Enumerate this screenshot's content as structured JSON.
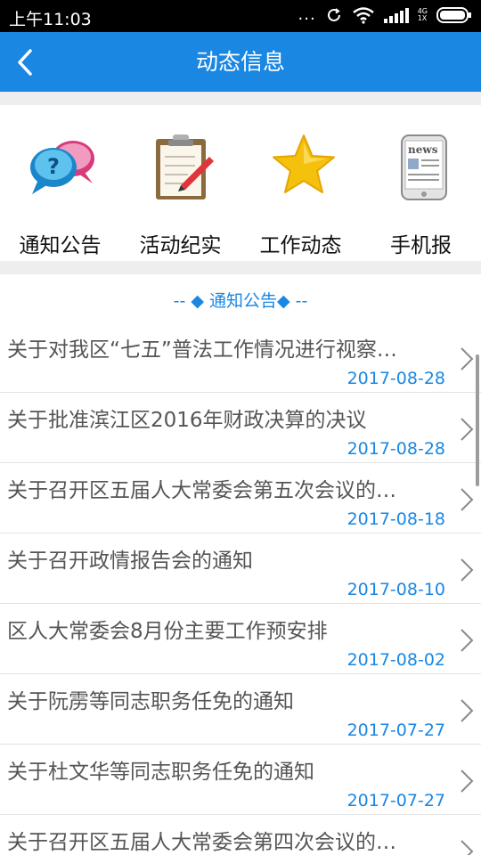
{
  "status_bar": {
    "time": "上午11:03",
    "dots": "...",
    "network": "4G",
    "network_sub": "1X"
  },
  "header": {
    "title": "动态信息",
    "back_icon": "chevron-left-icon"
  },
  "quick_menu": [
    {
      "label": "通知公告",
      "icon": "speech-bubbles-question-icon"
    },
    {
      "label": "活动纪实",
      "icon": "clipboard-pen-icon"
    },
    {
      "label": "工作动态",
      "icon": "star-icon"
    },
    {
      "label": "手机报",
      "icon": "news-phone-icon"
    }
  ],
  "section": {
    "title": "-- ◆ 通知公告◆ --"
  },
  "news": [
    {
      "title": "关于对我区“七五”普法工作情况进行视察…",
      "date": "2017-08-28"
    },
    {
      "title": "关于批准滨江区2016年财政决算的决议",
      "date": "2017-08-28"
    },
    {
      "title": "关于召开区五届人大常委会第五次会议的…",
      "date": "2017-08-18"
    },
    {
      "title": "关于召开政情报告会的通知",
      "date": "2017-08-10"
    },
    {
      "title": "区人大常委会8月份主要工作预安排",
      "date": "2017-08-02"
    },
    {
      "title": "关于阮雳等同志职务任免的通知",
      "date": "2017-07-27"
    },
    {
      "title": "关于杜文华等同志职务任免的通知",
      "date": "2017-07-27"
    },
    {
      "title": "关于召开区五届人大常委会第四次会议的…",
      "date": ""
    }
  ],
  "colors": {
    "accent": "#1a87e3",
    "divider": "#eeeeee"
  }
}
